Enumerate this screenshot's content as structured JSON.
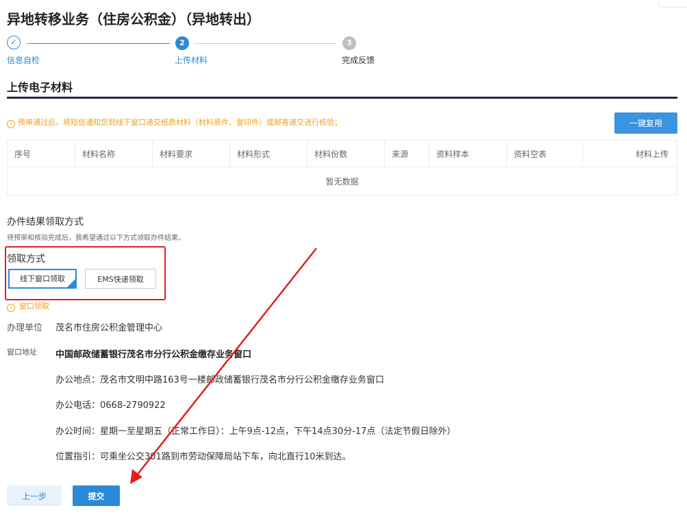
{
  "page": {
    "title": "异地转移业务（住房公积金）（异地转出）"
  },
  "steps": [
    {
      "number": "✓",
      "label": "信息自检"
    },
    {
      "number": "2",
      "label": "上传材料"
    },
    {
      "number": "3",
      "label": "完成反馈"
    }
  ],
  "materials": {
    "title": "上传电子材料",
    "notice": "预审通过后，将短信通知您到线下窗口递交纸质材料（材料原件、复印件）或邮寄递交进行核验；",
    "reuse_button": "一键复用",
    "columns": [
      "序号",
      "材料名称",
      "材料要求",
      "材料形式",
      "材料份数",
      "来源",
      "资料样本",
      "资料空表",
      "材料上传"
    ],
    "empty_text": "暂无数据"
  },
  "result": {
    "title": "办件结果领取方式",
    "desc": "待预审和核验完成后，我希望通过以下方式领取办件结果。",
    "method_label": "领取方式",
    "options": [
      "线下窗口领取",
      "EMS快递领取"
    ],
    "selected_option": "线下窗口领取",
    "window_note": "窗口领取",
    "unit_label": "办理单位",
    "unit_value": "茂名市住房公积金管理中心",
    "address_label": "窗口地址",
    "window_name": "中国邮政储蓄银行茂名市分行公积金缴存业务窗口",
    "office_location": "办公地点：茂名市文明中路163号一楼邮政储蓄银行茂名市分行公积金缴存业务窗口",
    "office_phone": "办公电话：0668-2790922",
    "office_hours": "办公时间：星期一至星期五（正常工作日）：上午9点-12点，下午14点30分-17点（法定节假日除外）",
    "directions": "位置指引：可乘坐公交301路到市劳动保障局站下车，向北直行10米到达。"
  },
  "footer": {
    "prev_button": "上一步",
    "submit_button": "提交"
  },
  "colors": {
    "accent": "#2a8ad8",
    "warning": "#f0a020",
    "annotation": "#e02020"
  }
}
